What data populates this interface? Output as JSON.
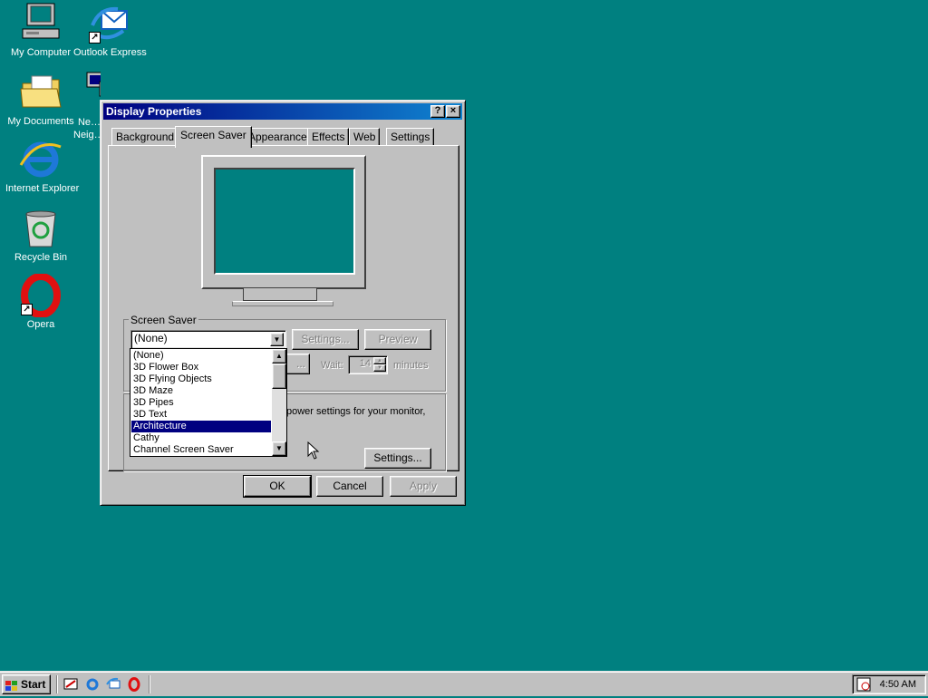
{
  "desktop": {
    "icons": [
      {
        "label": "My Computer"
      },
      {
        "label": "Outlook Express"
      },
      {
        "label": "My Documents"
      },
      {
        "label": "Ne… Neig…"
      },
      {
        "label": "Internet Explorer"
      },
      {
        "label": "Recycle Bin"
      },
      {
        "label": "Opera"
      }
    ]
  },
  "window": {
    "title": "Display Properties",
    "help_label": "?",
    "close_label": "×",
    "tabs": [
      {
        "label": "Background"
      },
      {
        "label": "Screen Saver"
      },
      {
        "label": "Appearance"
      },
      {
        "label": "Effects"
      },
      {
        "label": "Web"
      },
      {
        "label": "Settings"
      }
    ],
    "active_tab": "Screen Saver",
    "screen_saver": {
      "group_title": "Screen Saver",
      "selected_value": "(None)",
      "settings_label": "Settings...",
      "preview_label": "Preview",
      "password_label": "...",
      "wait_label": "Wait:",
      "wait_value": "14",
      "minutes_label": "minutes",
      "options": [
        "(None)",
        "3D Flower Box",
        "3D Flying Objects",
        "3D Maze",
        "3D Pipes",
        "3D Text",
        "Architecture",
        "Cathy",
        "Channel Screen Saver"
      ],
      "highlighted_option": "Architecture"
    },
    "energy": {
      "text": "power settings for your monitor,",
      "settings_label": "Settings..."
    },
    "buttons": {
      "ok": "OK",
      "cancel": "Cancel",
      "apply": "Apply"
    }
  },
  "taskbar": {
    "start_label": "Start",
    "clock": "4:50 AM"
  },
  "colors": {
    "desktop": "#008080",
    "titlebar": "#000080",
    "selection": "#000080",
    "face": "#c0c0c0"
  }
}
